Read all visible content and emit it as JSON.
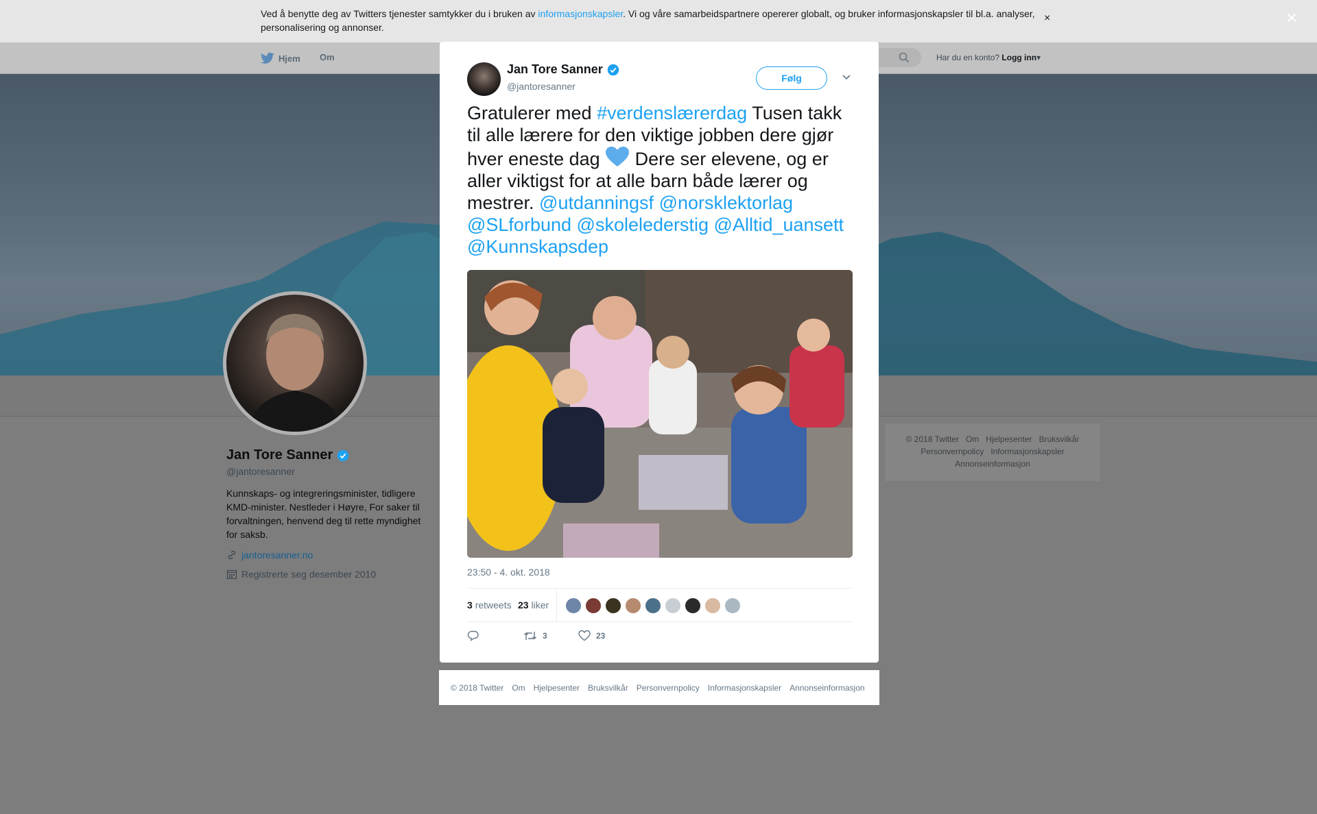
{
  "cookie_banner": {
    "text_before": "Ved å benytte deg av Twitters tjenester samtykker du i bruken av ",
    "link": "informasjonskapsler",
    "text_after": ". Vi og våre samarbeidspartnere opererer globalt, og bruker informasjonskapsler til bl.a. analyser, personalisering og annonser.",
    "close": "×"
  },
  "topnav": {
    "home": "Hjem",
    "about": "Om",
    "account_question": "Har du en konto?",
    "login": "Logg inn"
  },
  "profile": {
    "name": "Jan Tore Sanner",
    "handle": "@jantoresanner",
    "bio": "Kunnskaps- og integreringsminister, tidligere KMD-minister. Nestleder i Høyre, For saker til forvaltningen, henvend deg til rette myndighet for saksb.",
    "website": "jantoresanner.no",
    "joined": "Registrerte seg desember 2010"
  },
  "side_footer": {
    "items": [
      "© 2018 Twitter",
      "Om",
      "Hjelpesenter",
      "Bruksvilkår",
      "Personvernpolicy",
      "Informasjonskapsler",
      "Annonseinformasjon"
    ]
  },
  "modal_close": "×",
  "tweet": {
    "author_name": "Jan Tore Sanner",
    "author_handle": "@jantoresanner",
    "follow_label": "Følg",
    "text_1": "Gratulerer med ",
    "hashtag": "#verdenslærerdag",
    "text_2": " Tusen takk til alle lærere for den viktige jobben dere gjør hver eneste dag ",
    "emoji": "blue-heart",
    "text_3": " Dere ser elevene, og er aller viktigst for at alle barn både lærer og mestrer. ",
    "mentions": [
      "@utdanningsf",
      "@norsklektorlag",
      "@SLforbund",
      "@skolelederstig",
      "@Alltid_uansett",
      "@Kunnskapsdep"
    ],
    "timestamp": "23:50 - 4. okt. 2018",
    "retweets_count": "3",
    "retweets_label": "retweets",
    "likes_count": "23",
    "likes_label": "liker",
    "action_retweets": "3",
    "action_likes": "23"
  },
  "bottom_footer": {
    "items": [
      "© 2018 Twitter",
      "Om",
      "Hjelpesenter",
      "Bruksvilkår",
      "Personvernpolicy",
      "Informasjonskapsler",
      "Annonseinformasjon"
    ]
  },
  "colors": {
    "brand": "#1da1f2",
    "text": "#14171a",
    "muted": "#657786"
  }
}
